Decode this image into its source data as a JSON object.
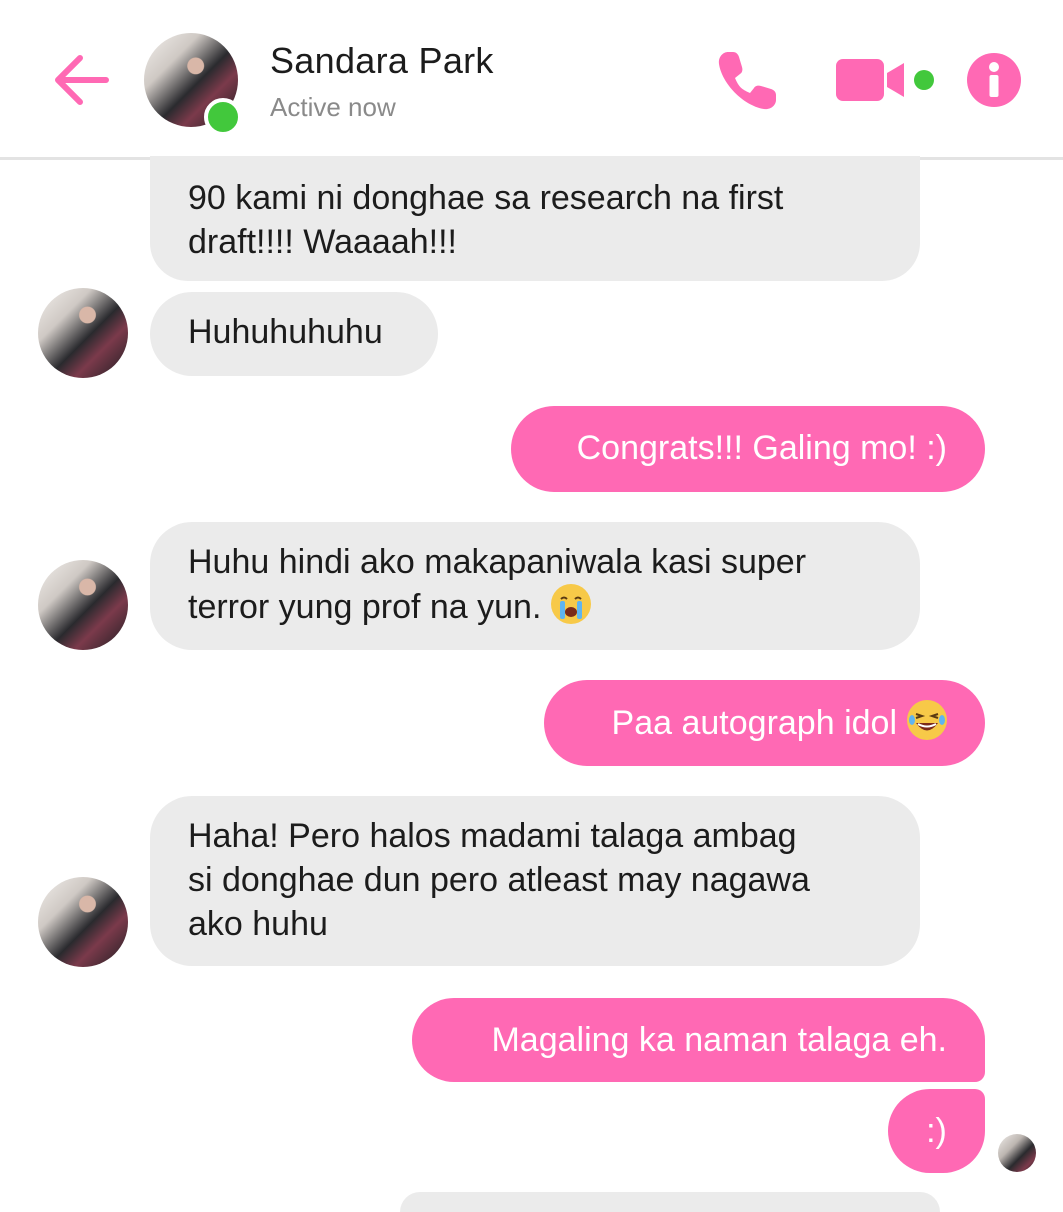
{
  "header": {
    "contact_name": "Sandara Park",
    "status": "Active now",
    "accent_color": "#ff69b4",
    "online_color": "#42c83c",
    "icons": {
      "back": "back-arrow-icon",
      "call": "phone-icon",
      "video": "video-camera-icon",
      "info": "info-icon"
    }
  },
  "messages": [
    {
      "from": "them",
      "text": "90 kami ni donghae sa research na first\ndraft!!!! Waaaah!!!"
    },
    {
      "from": "them",
      "text": "Huhuhuhuhu"
    },
    {
      "from": "me",
      "text": "Congrats!!! Galing mo! :)"
    },
    {
      "from": "them",
      "text": "Huhu hindi ako makapaniwala kasi super\nterror yung prof na yun.",
      "emoji": "crying-face-emoji"
    },
    {
      "from": "me",
      "text": "Paa autograph idol",
      "emoji": "laughing-face-emoji"
    },
    {
      "from": "them",
      "text": "Haha! Pero halos madami talaga ambag\nsi donghae dun pero atleast may nagawa\nako huhu"
    },
    {
      "from": "me",
      "text": "Magaling ka naman talaga eh."
    },
    {
      "from": "me",
      "text": ":)"
    }
  ]
}
